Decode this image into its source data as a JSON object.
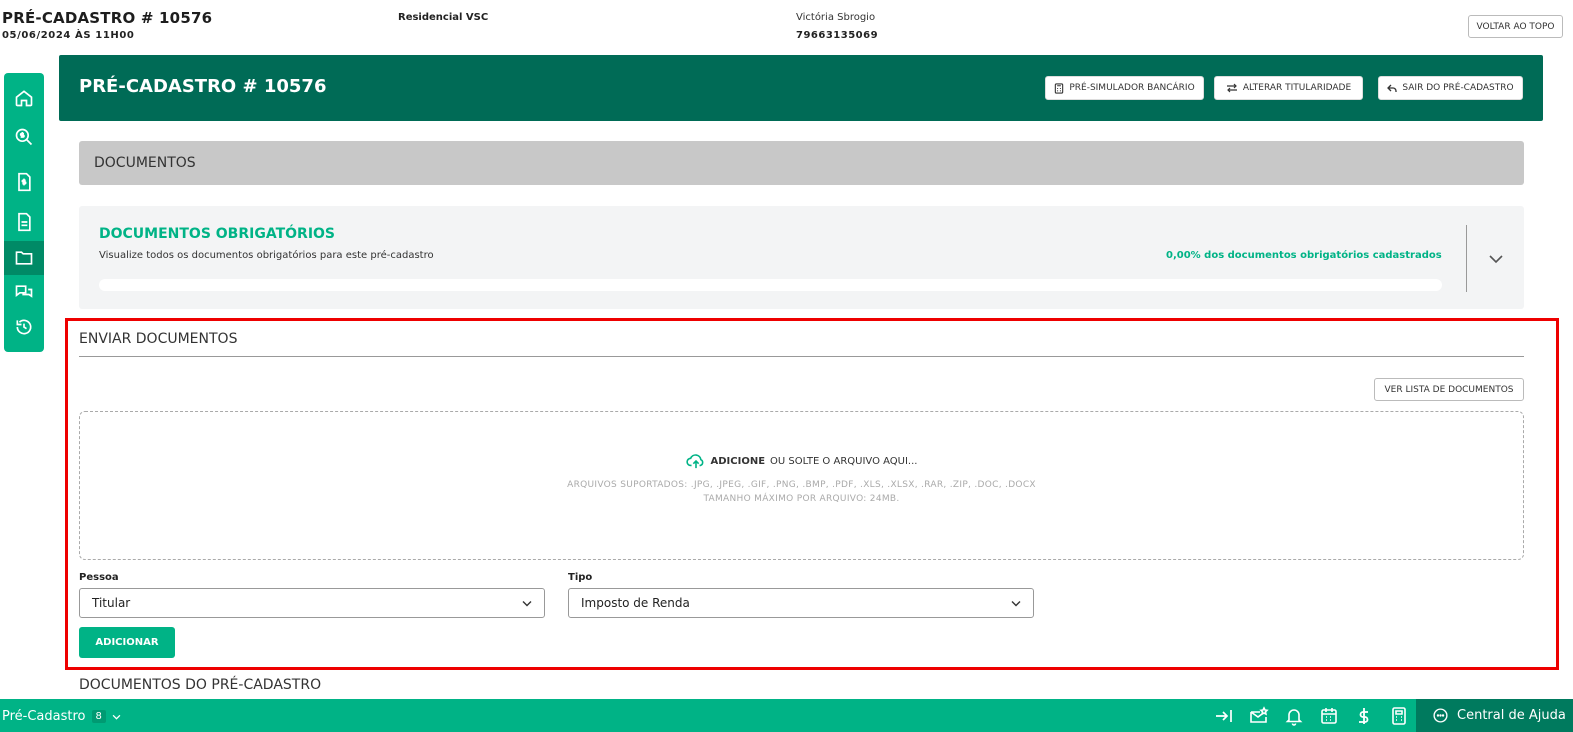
{
  "header": {
    "title": "PRÉ-CADASTRO # 10576",
    "date": "05/06/2024 ÀS 11H00",
    "residencial": "Residencial VSC",
    "client_name": "Victória Sbrogio",
    "client_phone": "79663135069",
    "back_to_top": "VOLTAR AO TOPO"
  },
  "sidebar": {
    "items": [
      {
        "icon": "home-icon"
      },
      {
        "icon": "search-dollar-icon"
      },
      {
        "icon": "document-dollar-icon"
      },
      {
        "icon": "document-icon"
      },
      {
        "icon": "folder-icon",
        "active": true
      },
      {
        "icon": "chat-icon"
      },
      {
        "icon": "history-icon"
      }
    ]
  },
  "banner": {
    "title": "PRÉ-CADASTRO # 10576",
    "btn_simulador": "PRÉ-SIMULADOR BANCÁRIO",
    "btn_alterar": "ALTERAR TITULARIDADE",
    "btn_sair": "SAIR DO PRÉ-CADASTRO"
  },
  "documentos": {
    "section_title": "DOCUMENTOS"
  },
  "obrigatorios": {
    "title": "DOCUMENTOS OBRIGATÓRIOS",
    "description": "Visualize todos os documentos obrigatórios para este pré-cadastro",
    "progress_text": "0,00% dos documentos obrigatórios cadastrados",
    "progress_fraction": 0
  },
  "enviar": {
    "title": "ENVIAR DOCUMENTOS",
    "btn_lista": "VER LISTA DE DOCUMENTOS",
    "drop_bold": "ADICIONE",
    "drop_rest": "OU SOLTE O ARQUIVO AQUI...",
    "supported": "ARQUIVOS SUPORTADOS: .JPG, .JPEG, .GIF, .PNG, .BMP, .PDF, .XLS, .XLSX, .RAR, .ZIP, .DOC, .DOCX",
    "max_size": "TAMANHO MÁXIMO POR ARQUIVO: 24MB.",
    "pessoa_label": "Pessoa",
    "pessoa_value": "Titular",
    "tipo_label": "Tipo",
    "tipo_value": "Imposto de Renda",
    "btn_adicionar": "ADICIONAR"
  },
  "docs_pre": {
    "title": "DOCUMENTOS DO PRÉ-CADASTRO"
  },
  "bottom": {
    "label": "Pré-Cadastro",
    "count": "8",
    "help": "Central de Ajuda"
  },
  "colors": {
    "primary": "#00b386",
    "banner": "#006b56",
    "highlight": "#ee0000"
  }
}
